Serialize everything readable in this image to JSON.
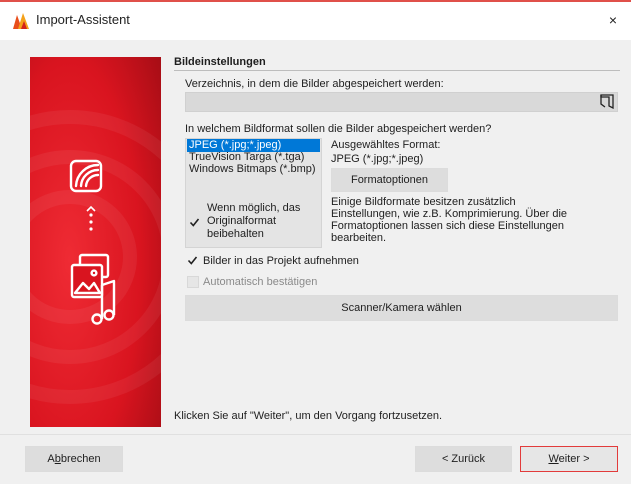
{
  "window": {
    "title": "Import-Assistent",
    "close_glyph": "×"
  },
  "section": {
    "title": "Bildeinstellungen"
  },
  "directory": {
    "label": "Verzeichnis, in dem die Bilder abgespeichert werden:",
    "value": ""
  },
  "format": {
    "question": "In welchem Bildformat sollen die Bilder abgespeichert werden?",
    "options": [
      "JPEG (*.jpg;*.jpeg)",
      "TrueVision Targa (*.tga)",
      "Windows Bitmaps (*.bmp)"
    ],
    "selected_index": 0,
    "selected_label": "Ausgewähltes Format:",
    "selected_value": "JPEG (*.jpg;*.jpeg)",
    "options_button": "Formatoptionen",
    "keep_original": {
      "lines": [
        "Wenn möglich, das",
        "Originalformat",
        "beibehalten"
      ],
      "checked": true
    },
    "info_lines": [
      "Einige Bildformate besitzen zusätzlich",
      "Einstellungen, wie z.B. Komprimierung. Über die",
      "Formatoptionen lassen sich diese Einstellungen",
      "bearbeiten."
    ]
  },
  "options": {
    "add_to_project": {
      "label": "Bilder in das Projekt aufnehmen",
      "checked": true
    },
    "auto_confirm": {
      "label": "Automatisch bestätigen",
      "checked": false,
      "disabled": true
    }
  },
  "scanner_button": "Scanner/Kamera wählen",
  "hint": "Klicken Sie auf \"Weiter\", um den Vorgang fortzusetzen.",
  "buttons": {
    "cancel": {
      "pre": "A",
      "mnemonic": "b",
      "post": "brechen"
    },
    "back": "< Zurück",
    "next": {
      "pre": "",
      "mnemonic": "W",
      "post": "eiter >"
    }
  },
  "colors": {
    "accent_red": "#e2222c",
    "selection_blue": "#0078d7"
  },
  "icons": [
    "app-icon",
    "close-icon",
    "folder-browse-icon",
    "image-import-icon",
    "dots-icon",
    "media-files-icon",
    "checkbox-checked-icon"
  ]
}
